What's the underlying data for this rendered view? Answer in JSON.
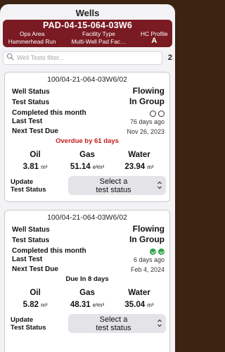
{
  "title": "Wells",
  "banner": {
    "pad": "PAD-04-15-064-03W6",
    "labels": [
      "Ops Area",
      "Facility Type",
      "HC Profile"
    ],
    "values": [
      "Hammerhead Run",
      "Multi-Well Pad Fac…",
      "A"
    ]
  },
  "search": {
    "placeholder": "Well Tests filter...",
    "count": "2"
  },
  "wells": [
    {
      "id": "100/04-21-064-03W6/02",
      "well_status_label": "Well Status",
      "well_status": "Flowing",
      "test_status_label": "Test Status",
      "test_status": "In Group",
      "completed_label": "Completed this month",
      "completed": [
        false,
        false
      ],
      "last_test_label": "Last Test",
      "last_test": "76 days ago",
      "next_due_label": "Next Test Due",
      "next_due": "Nov 26, 2023",
      "due_message": "Overdue by 61 days",
      "due_color": "#c41c1c",
      "oil_label": "Oil",
      "oil": "3.81",
      "oil_unit": "m³",
      "gas_label": "Gas",
      "gas": "51.14",
      "gas_unit": "e³m³",
      "water_label": "Water",
      "water": "23.94",
      "water_unit": "m³",
      "update_label_1": "Update",
      "update_label_2": "Test Status",
      "select_line_1": "Select a",
      "select_line_2": "test status"
    },
    {
      "id": "100/04-21-064-03W6/02",
      "well_status_label": "Well Status",
      "well_status": "Flowing",
      "test_status_label": "Test Status",
      "test_status": "In Group",
      "completed_label": "Completed this month",
      "completed": [
        true,
        true
      ],
      "last_test_label": "Last Test",
      "last_test": "6 days ago",
      "next_due_label": "Next Test Due",
      "next_due": "Feb 4, 2024",
      "due_message": "Due In 8 days",
      "due_color": "#111111",
      "oil_label": "Oil",
      "oil": "5.82",
      "oil_unit": "m³",
      "gas_label": "Gas",
      "gas": "48.31",
      "gas_unit": "e³m³",
      "water_label": "Water",
      "water": "35.04",
      "water_unit": "m³",
      "update_label_1": "Update",
      "update_label_2": "Test Status",
      "select_line_1": "Select a",
      "select_line_2": "test status"
    }
  ]
}
